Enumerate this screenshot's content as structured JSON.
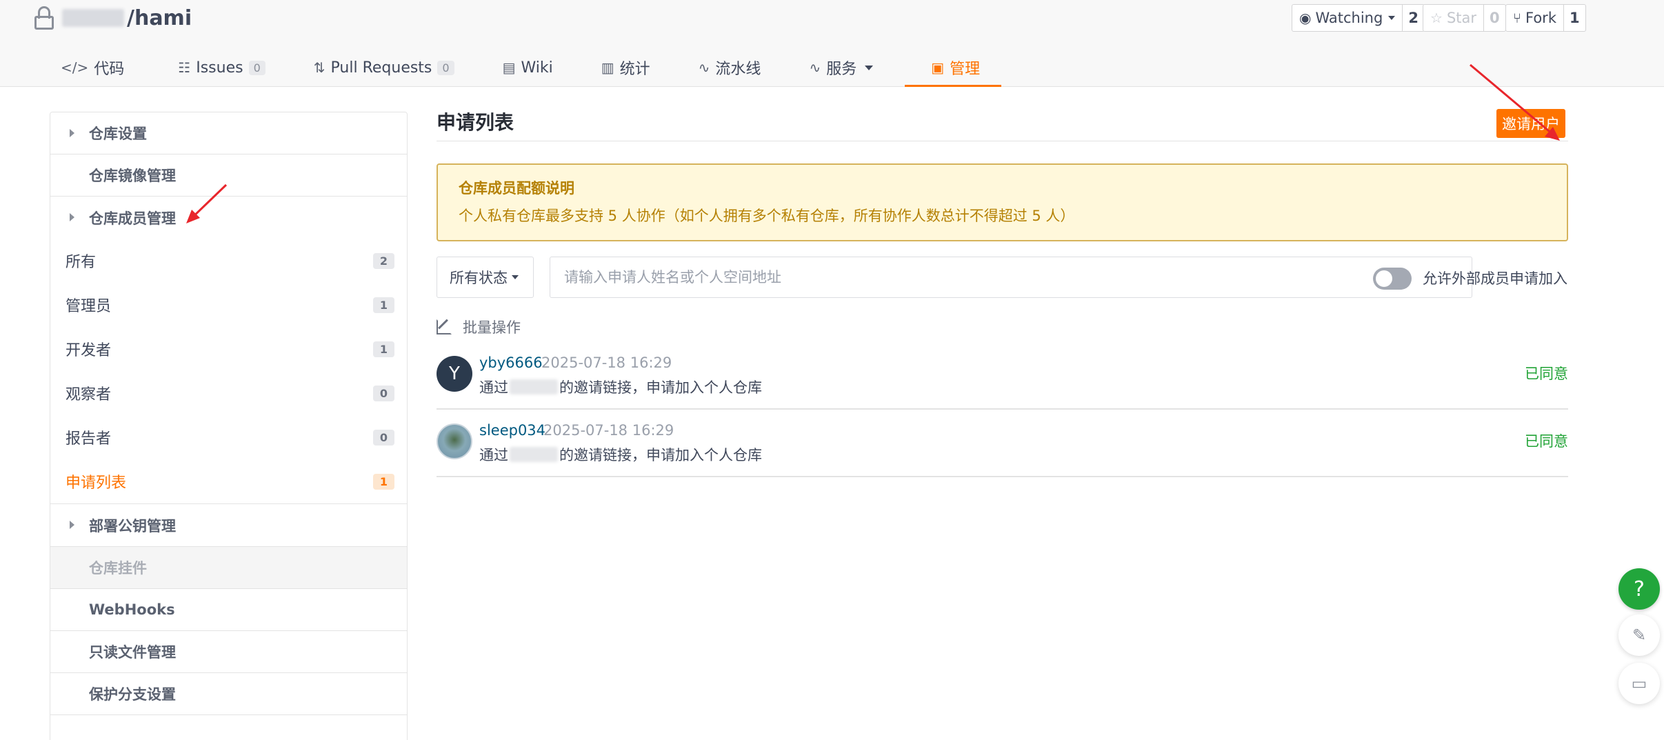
{
  "repo": {
    "name": "/hami"
  },
  "actions": [
    {
      "label": "Watching",
      "count": "2"
    },
    {
      "label": "Star",
      "count": "0"
    },
    {
      "label": "Fork",
      "count": "1"
    }
  ],
  "tabs": [
    {
      "icon": "</>",
      "label": "代码",
      "badge": ""
    },
    {
      "icon": "☷",
      "label": "Issues",
      "badge": "0"
    },
    {
      "icon": "⇅",
      "label": "Pull Requests",
      "badge": "0"
    },
    {
      "icon": "▤",
      "label": "Wiki",
      "badge": ""
    },
    {
      "icon": "▥",
      "label": "统计",
      "badge": ""
    },
    {
      "icon": "∿",
      "label": "流水线",
      "badge": ""
    },
    {
      "icon": "∿",
      "label": "服务",
      "badge": ""
    },
    {
      "icon": "▣",
      "label": "管理",
      "badge": ""
    }
  ],
  "sidebar": {
    "repo_settings": "仓库设置",
    "mirror": "仓库镜像管理",
    "members": "仓库成员管理",
    "items": [
      {
        "label": "所有",
        "count": "2"
      },
      {
        "label": "管理员",
        "count": "1"
      },
      {
        "label": "开发者",
        "count": "1"
      },
      {
        "label": "观察者",
        "count": "0"
      },
      {
        "label": "报告者",
        "count": "0"
      },
      {
        "label": "申请列表",
        "count": "1"
      }
    ],
    "deploy_keys": "部署公钥管理",
    "plugins": "仓库挂件",
    "webhooks": "WebHooks",
    "readonly": "只读文件管理",
    "branch_protect": "保护分支设置"
  },
  "main": {
    "title": "申请列表",
    "invite_label": "邀请用户",
    "notice_title": "仓库成员配额说明",
    "notice_text": "个人私有仓库最多支持 5 人协作（如个人拥有多个私有仓库，所有协作人数总计不得超过 5 人）",
    "status_filter": "所有状态",
    "search_placeholder": "请输入申请人姓名或个人空间地址",
    "toggle_label": "允许外部成员申请加入",
    "batch_label": "批量操作",
    "requests": [
      {
        "avatar": "Y",
        "user": "yby6666",
        "time": "2025-07-18 16:29",
        "desc_prefix": "通过",
        "desc_suffix": "的邀请链接，申请加入个人仓库",
        "status": "已同意"
      },
      {
        "avatar": "",
        "user": "sleep034",
        "time": "2025-07-18 16:29",
        "desc_prefix": "通过",
        "desc_suffix": "的邀请链接，申请加入个人仓库",
        "status": "已同意"
      }
    ]
  },
  "floating": {
    "help": "?"
  },
  "colors": {
    "accent": "#fe7300",
    "success": "#21a336",
    "link": "#005980",
    "arrow": "#e8262c"
  }
}
